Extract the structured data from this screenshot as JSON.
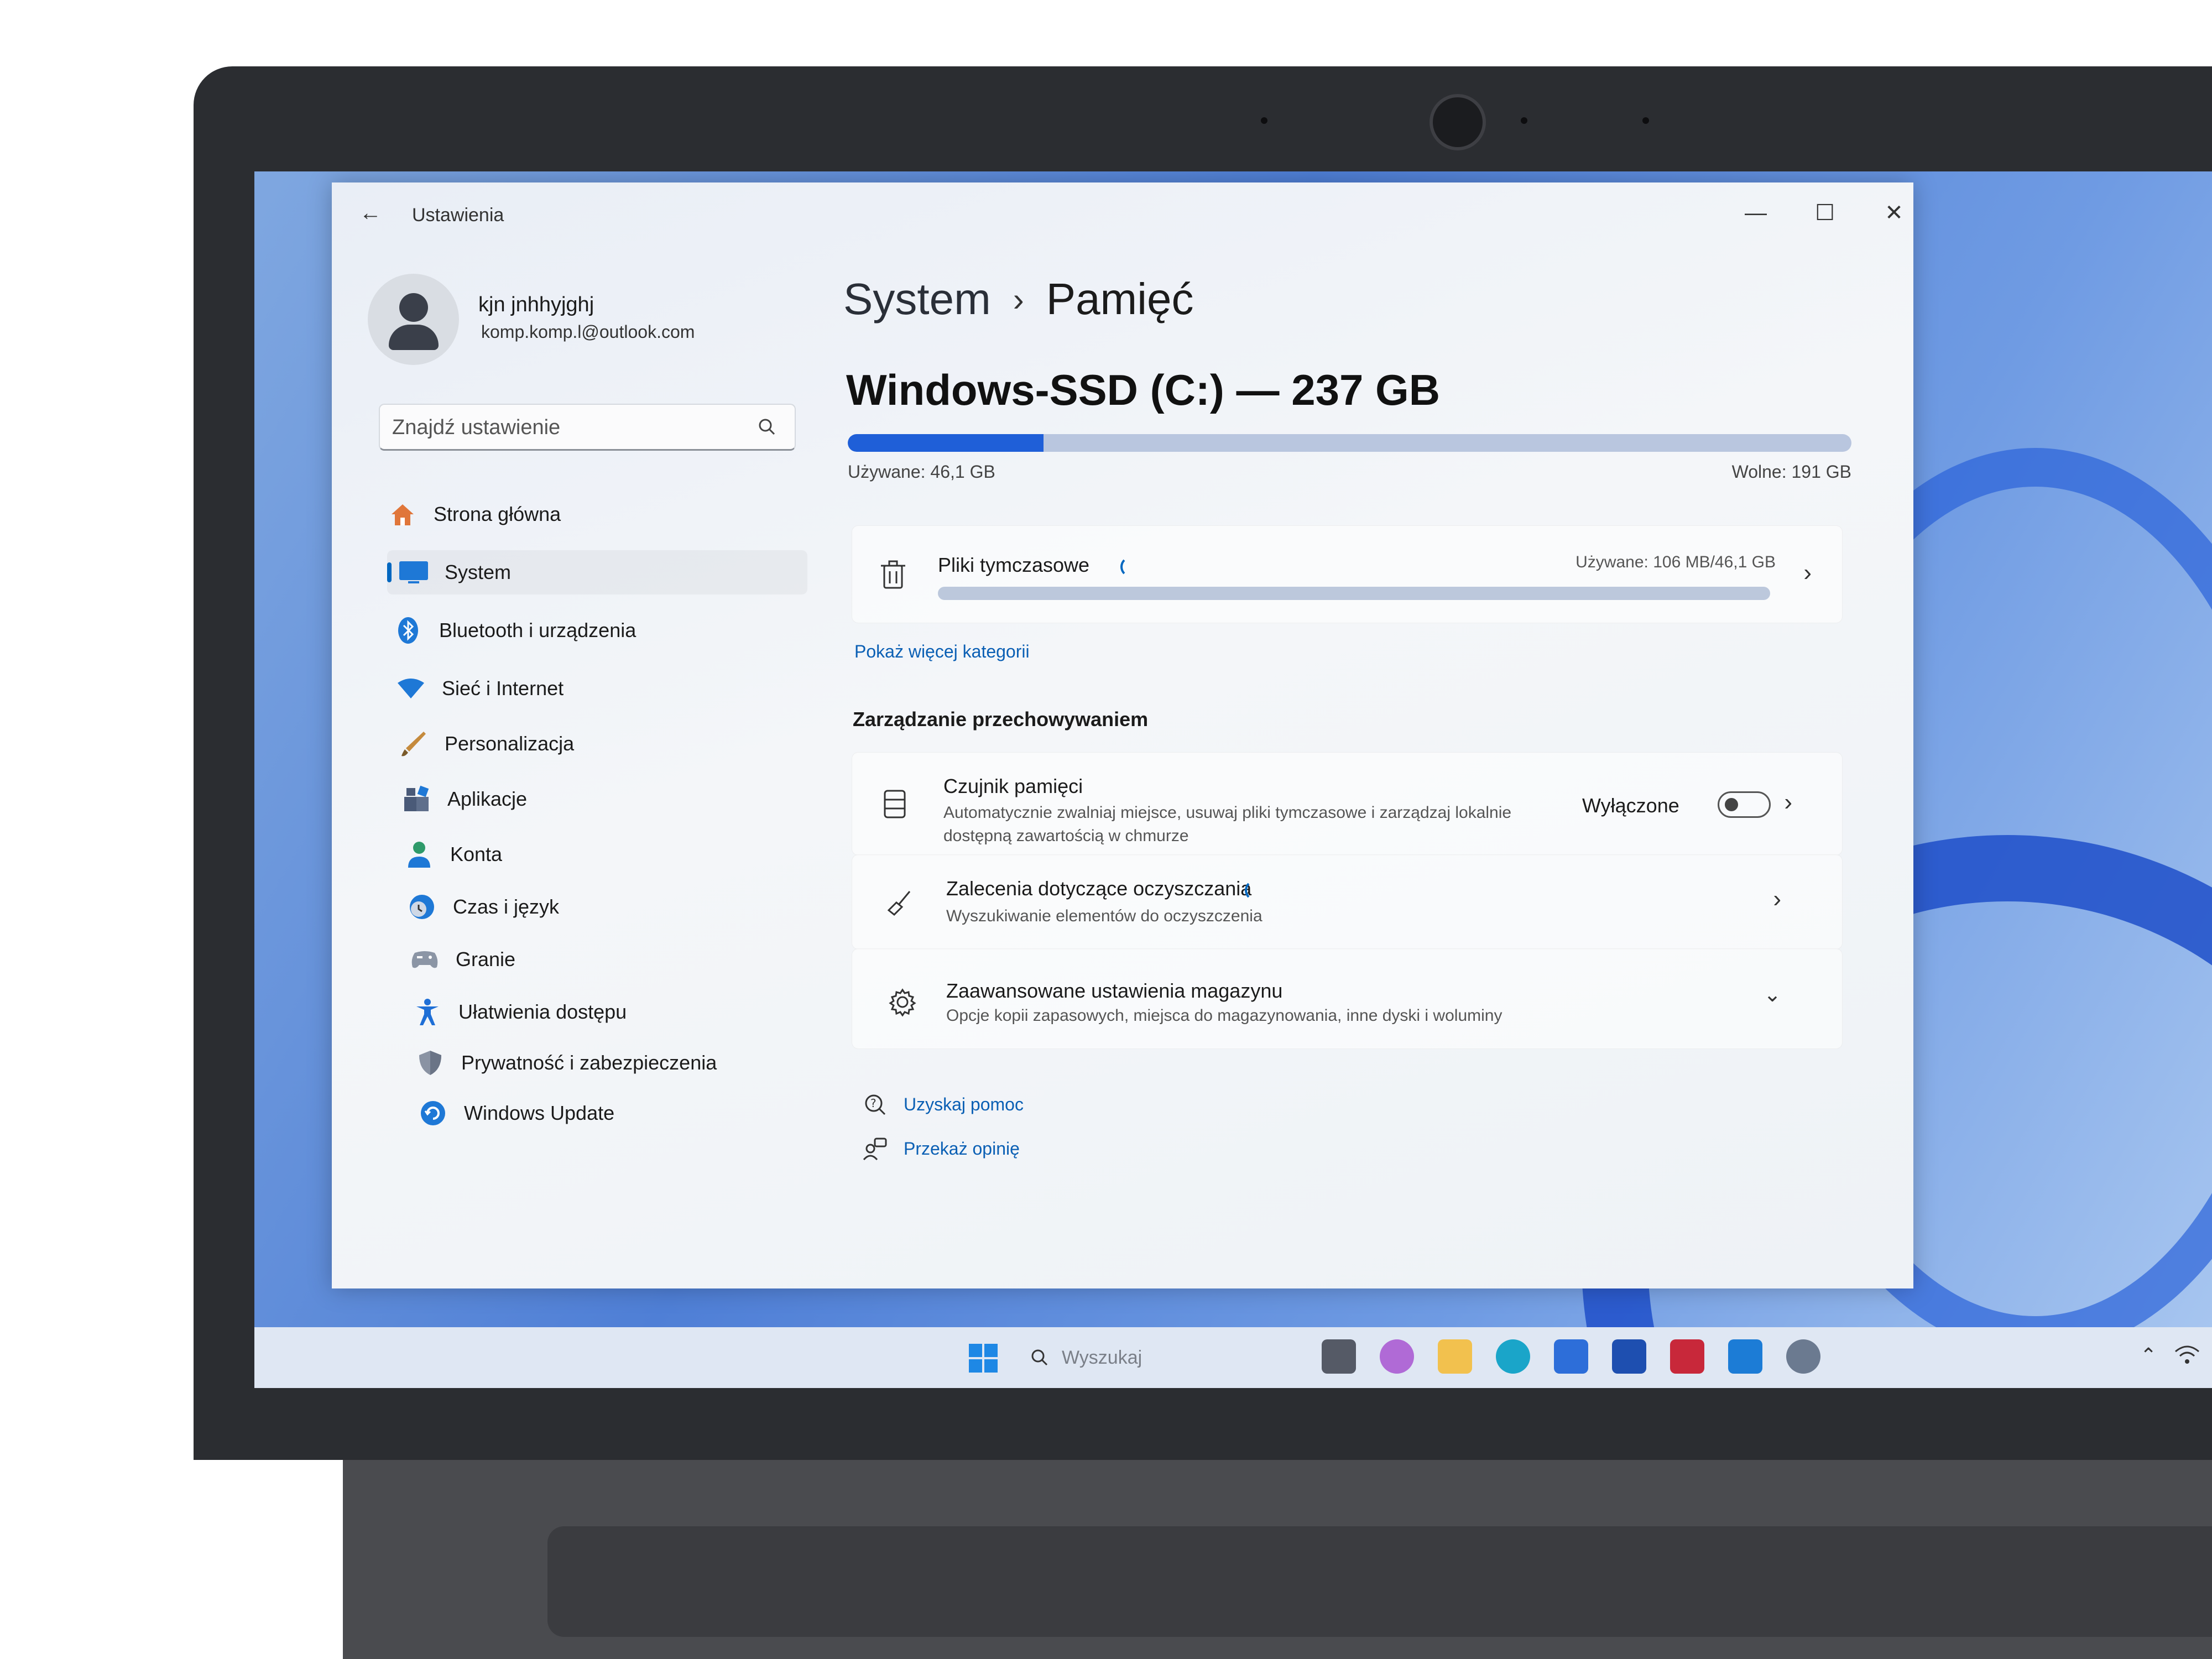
{
  "window": {
    "title": "Ustawienia",
    "minimize": "—",
    "maximize": "☐",
    "close": "✕",
    "back": "←"
  },
  "user": {
    "name": "kjn jnhhyjghj",
    "email": "komp.komp.l@outlook.com"
  },
  "search": {
    "placeholder": "Znajdź ustawienie"
  },
  "nav": {
    "items": [
      {
        "label": "Strona główna",
        "icon": "home-icon"
      },
      {
        "label": "System",
        "icon": "monitor-icon"
      },
      {
        "label": "Bluetooth i urządzenia",
        "icon": "bluetooth-icon"
      },
      {
        "label": "Sieć i Internet",
        "icon": "wifi-icon"
      },
      {
        "label": "Personalizacja",
        "icon": "brush-icon"
      },
      {
        "label": "Aplikacje",
        "icon": "apps-icon"
      },
      {
        "label": "Konta",
        "icon": "person-icon"
      },
      {
        "label": "Czas i język",
        "icon": "globe-clock-icon"
      },
      {
        "label": "Granie",
        "icon": "gamepad-icon"
      },
      {
        "label": "Ułatwienia dostępu",
        "icon": "accessibility-icon"
      },
      {
        "label": "Prywatność i zabezpieczenia",
        "icon": "shield-icon"
      },
      {
        "label": "Windows Update",
        "icon": "update-icon"
      }
    ],
    "active_index": 1
  },
  "breadcrumb": {
    "parent": "System",
    "separator": "›",
    "current": "Pamięć"
  },
  "disk": {
    "title": "Windows-SSD (C:) — 237 GB",
    "used_label": "Używane: 46,1 GB",
    "free_label": "Wolne: 191 GB",
    "used_fraction": 0.195
  },
  "temp_files": {
    "title": "Pliki tymczasowe",
    "usage": "Używane: 106 MB/46,1 GB"
  },
  "more_categories": "Pokaż więcej kategorii",
  "storage_management": {
    "heading": "Zarządzanie przechowywaniem",
    "sense": {
      "title": "Czujnik pamięci",
      "description": "Automatycznie zwalniaj miejsce, usuwaj pliki tymczasowe i zarządzaj lokalnie dostępną zawartością w chmurze",
      "state": "Wyłączone"
    },
    "cleanup": {
      "title": "Zalecenia dotyczące oczyszczania",
      "description": "Wyszukiwanie elementów do oczyszczenia"
    },
    "advanced": {
      "title": "Zaawansowane ustawienia magazynu",
      "description": "Opcje kopii zapasowych, miejsca do magazynowania, inne dyski i woluminy"
    }
  },
  "footer": {
    "help": "Uzyskaj pomoc",
    "feedback": "Przekaż opinię"
  },
  "taskbar": {
    "search_placeholder": "Wyszukaj"
  },
  "colors": {
    "accent": "#0067c0",
    "disk_fill": "#1f5fd8",
    "taskbar": "#dfe7f3"
  }
}
